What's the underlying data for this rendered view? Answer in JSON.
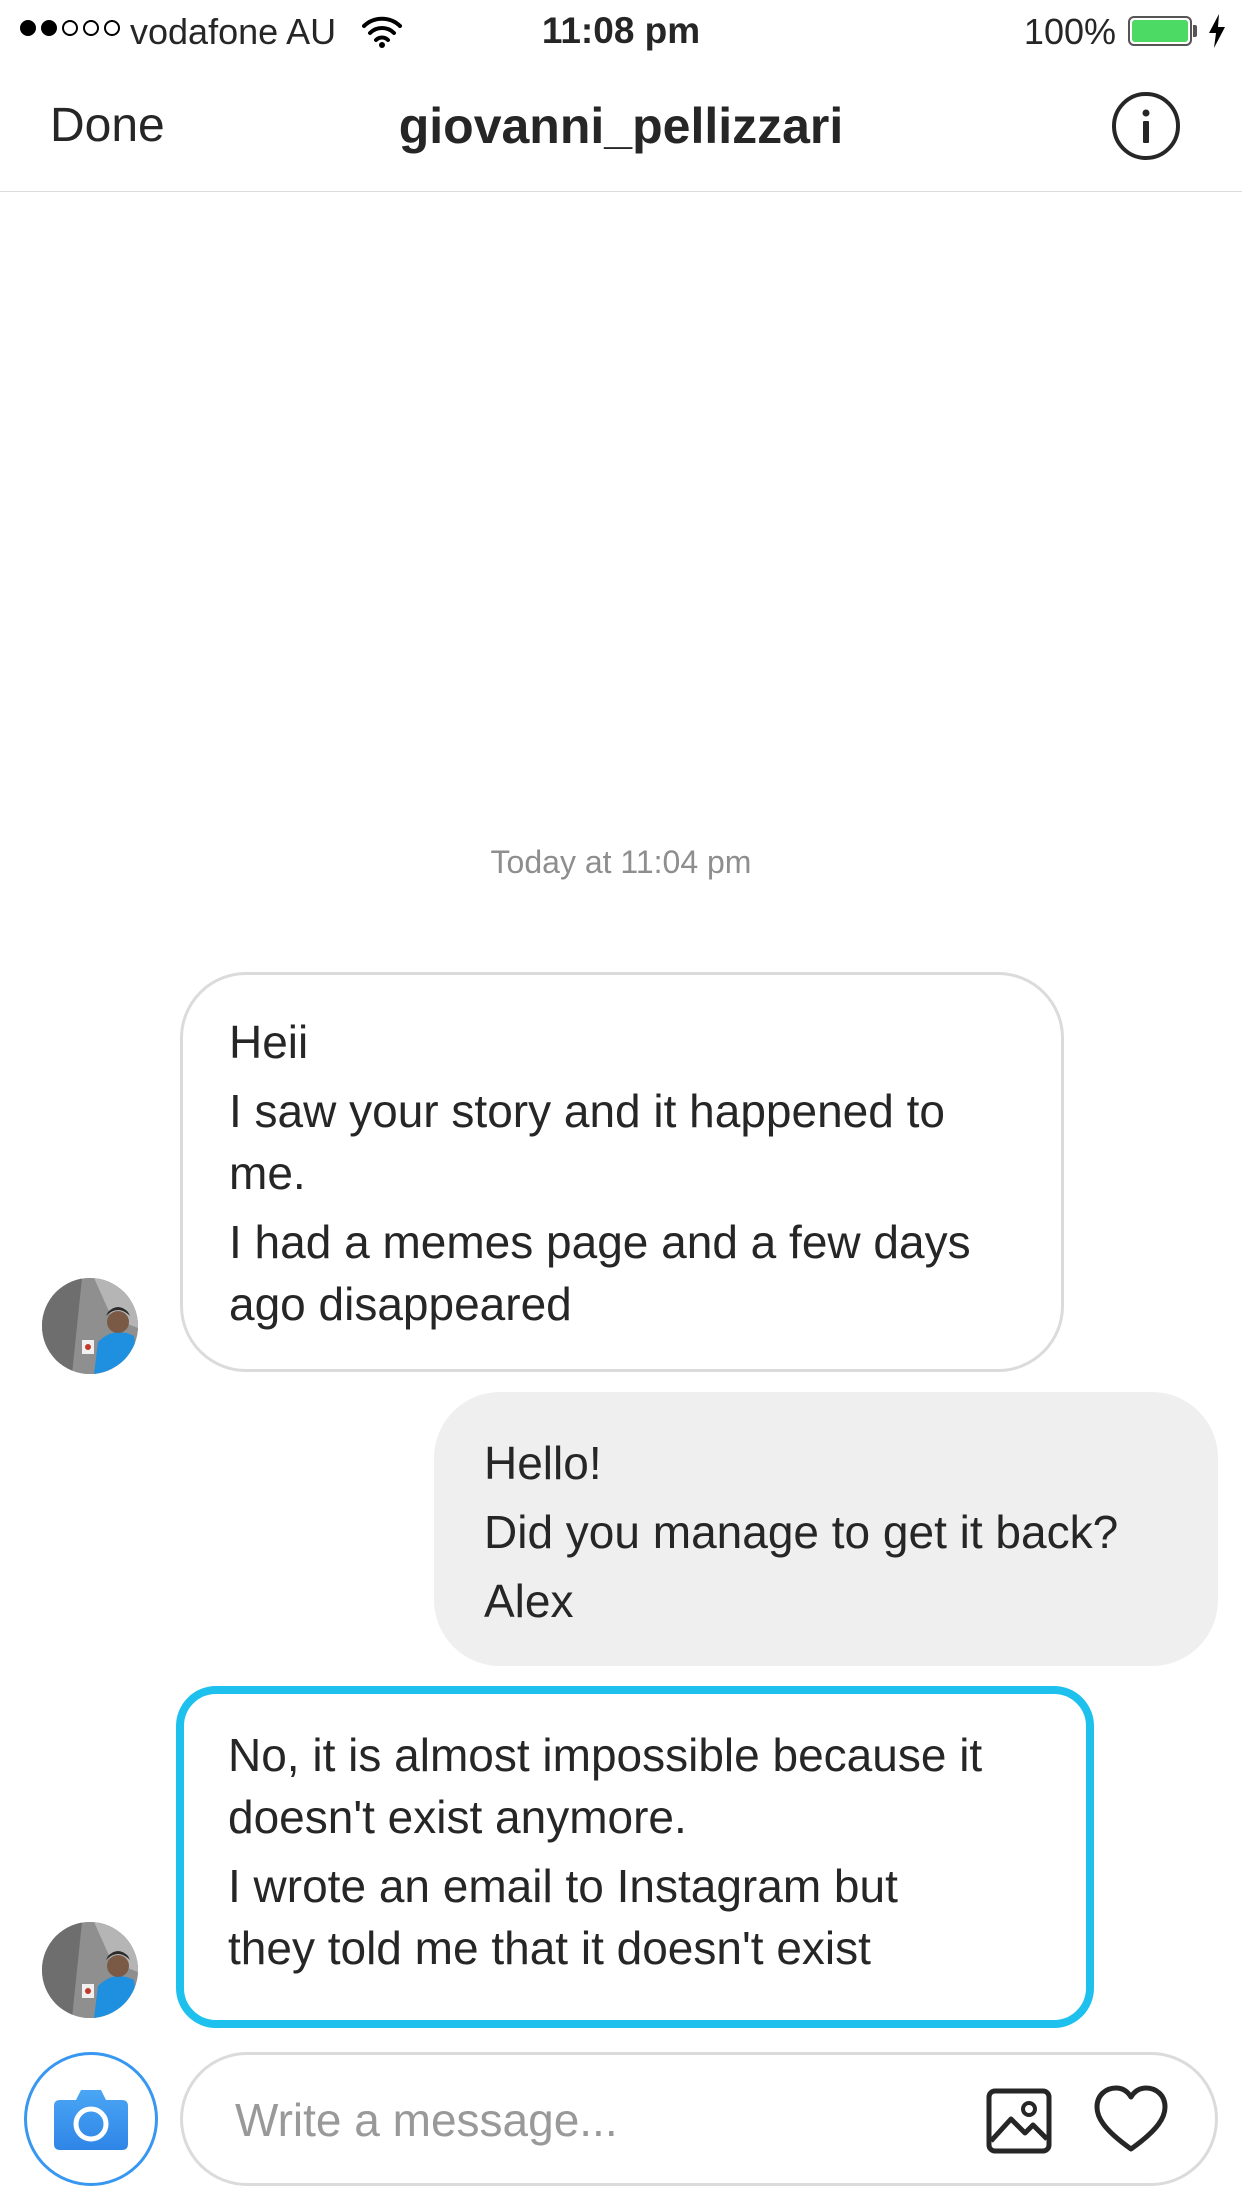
{
  "status_bar": {
    "carrier": "vodafone AU",
    "time": "11:08 pm",
    "battery_percent": "100%",
    "signal_bars_filled": 2,
    "signal_bars_total": 5,
    "battery_level": 1.0,
    "charging": true
  },
  "header": {
    "done_label": "Done",
    "title": "giovanni_pellizzari",
    "info_icon": "info-circle-icon"
  },
  "thread": {
    "timestamp": "Today at 11:04 pm",
    "messages": [
      {
        "direction": "incoming",
        "sender": "giovanni_pellizzari",
        "lines": [
          "Heii",
          "I saw your story and it happened to\nme.",
          "I had a memes page and a few days\nago disappeared"
        ]
      },
      {
        "direction": "outgoing",
        "lines": [
          "Hello!",
          "Did you manage to get it back?",
          "Alex"
        ]
      },
      {
        "direction": "incoming",
        "sender": "giovanni_pellizzari",
        "highlighted": true,
        "lines": [
          "No, it is almost impossible because it\ndoesn't exist anymore.",
          "I wrote an email to Instagram but\nthey told me that it doesn't exist"
        ]
      }
    ]
  },
  "composer": {
    "placeholder": "Write a message...",
    "camera_icon": "camera-icon",
    "gallery_icon": "gallery-icon",
    "like_icon": "heart-icon"
  },
  "colors": {
    "highlight_border": "#1ec0ee",
    "camera_blue": "#3897f0",
    "battery_green": "#4cd964",
    "outgoing_bubble": "#efefef"
  }
}
